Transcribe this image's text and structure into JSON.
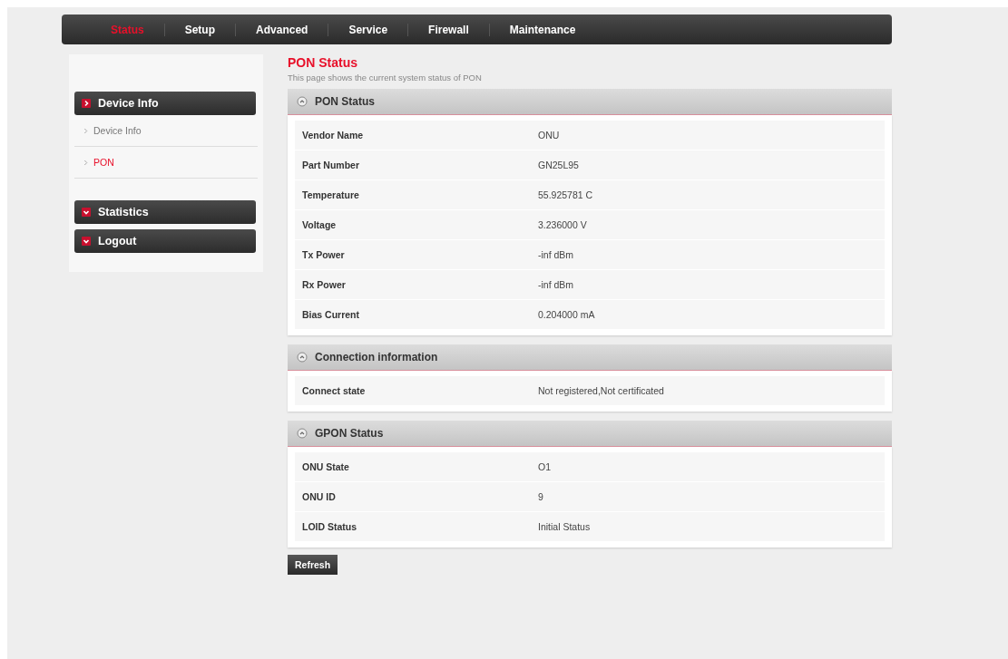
{
  "nav": [
    {
      "label": "Status",
      "selected": true
    },
    {
      "label": "Setup",
      "selected": false
    },
    {
      "label": "Advanced",
      "selected": false
    },
    {
      "label": "Service",
      "selected": false
    },
    {
      "label": "Firewall",
      "selected": false
    },
    {
      "label": "Maintenance",
      "selected": false
    }
  ],
  "sidebar": {
    "groups": [
      {
        "label": "Device Info",
        "expanded": true,
        "items": [
          {
            "label": "Device Info",
            "selected": false
          },
          {
            "label": "PON",
            "selected": true
          }
        ]
      },
      {
        "label": "Statistics",
        "expanded": false
      },
      {
        "label": "Logout",
        "expanded": false
      }
    ]
  },
  "page": {
    "title": "PON Status",
    "description": "This page shows the current system status of PON"
  },
  "sections": [
    {
      "title": "PON Status",
      "rows": [
        {
          "label": "Vendor Name",
          "value": "ONU"
        },
        {
          "label": "Part Number",
          "value": "GN25L95"
        },
        {
          "label": "Temperature",
          "value": "55.925781 C"
        },
        {
          "label": "Voltage",
          "value": "3.236000 V"
        },
        {
          "label": "Tx Power",
          "value": "-inf dBm"
        },
        {
          "label": "Rx Power",
          "value": "-inf dBm"
        },
        {
          "label": "Bias Current",
          "value": "0.204000 mA"
        }
      ]
    },
    {
      "title": "Connection information",
      "rows": [
        {
          "label": "Connect state",
          "value": "Not registered,Not certificated"
        }
      ]
    },
    {
      "title": "GPON Status",
      "rows": [
        {
          "label": "ONU State",
          "value": "O1"
        },
        {
          "label": "ONU ID",
          "value": "9"
        },
        {
          "label": "LOID Status",
          "value": "Initial Status"
        }
      ]
    }
  ],
  "button": "Refresh"
}
